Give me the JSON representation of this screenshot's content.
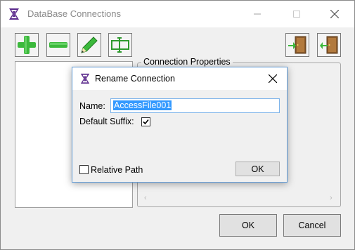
{
  "window": {
    "title": "DataBase Connections",
    "icon": "app-logo-icon",
    "controls": [
      "minimize-icon",
      "maximize-icon",
      "close-icon"
    ]
  },
  "toolbar": {
    "buttons": [
      {
        "name": "add",
        "icon": "plus-icon",
        "color": "#3cb93c"
      },
      {
        "name": "remove",
        "icon": "minus-icon",
        "color": "#3cb93c"
      },
      {
        "name": "edit",
        "icon": "pencil-icon",
        "color": "#3cb93c"
      },
      {
        "name": "rename",
        "icon": "rename-field-icon",
        "color": "#2e9a2e"
      }
    ],
    "right_buttons": [
      {
        "name": "import",
        "icon": "door-enter-icon"
      },
      {
        "name": "export",
        "icon": "door-exit-icon"
      }
    ]
  },
  "properties": {
    "group_label": "Connection Properties"
  },
  "footer": {
    "ok_label": "OK",
    "cancel_label": "Cancel"
  },
  "dialog": {
    "title": "Rename Connection",
    "name_label": "Name:",
    "name_value": "AccessFile001",
    "default_suffix_label": "Default Suffix:",
    "default_suffix_checked": true,
    "relative_path_label": "Relative Path",
    "relative_path_checked": false,
    "ok_label": "OK",
    "selection_color": "#3399ff"
  }
}
